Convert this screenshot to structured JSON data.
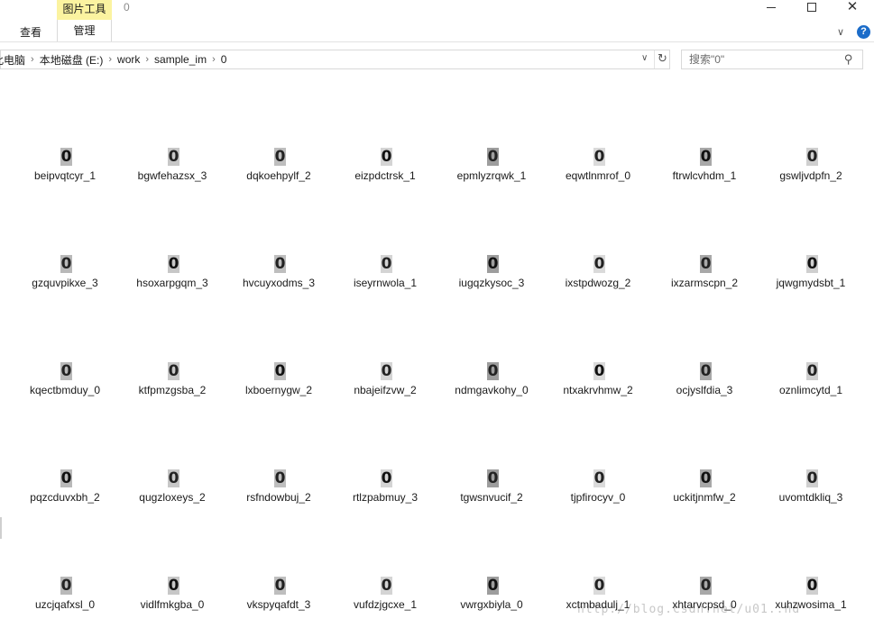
{
  "ribbon": {
    "tab_view": "查看",
    "context_group": "图片工具",
    "tab_manage": "管理",
    "window_title": "0"
  },
  "address": {
    "crumbs": [
      "此电脑",
      "本地磁盘 (E:)",
      "work",
      "sample_im",
      "0"
    ]
  },
  "search": {
    "placeholder": "搜索\"0\""
  },
  "files": [
    {
      "name": "beipvqtcyr_1",
      "glyph": "0"
    },
    {
      "name": "bgwfehazsx_3",
      "glyph": "0"
    },
    {
      "name": "dqkoehpylf_2",
      "glyph": "0"
    },
    {
      "name": "eizpdctrsk_1",
      "glyph": "0"
    },
    {
      "name": "epmlyzrqwk_1",
      "glyph": "0"
    },
    {
      "name": "eqwtlnmrof_0",
      "glyph": "0"
    },
    {
      "name": "ftrwlcvhdm_1",
      "glyph": "0"
    },
    {
      "name": "gswljvdpfn_2",
      "glyph": "0"
    },
    {
      "name": "gzquvpikxe_3",
      "glyph": "0"
    },
    {
      "name": "hsoxarpgqm_3",
      "glyph": "0"
    },
    {
      "name": "hvcuyxodms_3",
      "glyph": "0"
    },
    {
      "name": "iseyrnwola_1",
      "glyph": "0"
    },
    {
      "name": "iugqzkysoc_3",
      "glyph": "0"
    },
    {
      "name": "ixstpdwozg_2",
      "glyph": "0"
    },
    {
      "name": "ixzarmscpn_2",
      "glyph": "0"
    },
    {
      "name": "jqwgmydsbt_1",
      "glyph": "0"
    },
    {
      "name": "kqectbmduy_0",
      "glyph": "0"
    },
    {
      "name": "ktfpmzgsba_2",
      "glyph": "0"
    },
    {
      "name": "lxboernygw_2",
      "glyph": "0"
    },
    {
      "name": "nbajeifzvw_2",
      "glyph": "0"
    },
    {
      "name": "ndmgavkohy_0",
      "glyph": "0"
    },
    {
      "name": "ntxakrvhmw_2",
      "glyph": "0"
    },
    {
      "name": "ocjyslfdia_3",
      "glyph": "0"
    },
    {
      "name": "oznlimcytd_1",
      "glyph": "0"
    },
    {
      "name": "pqzcduvxbh_2",
      "glyph": "0"
    },
    {
      "name": "qugzloxeys_2",
      "glyph": "0"
    },
    {
      "name": "rsfndowbuj_2",
      "glyph": "0"
    },
    {
      "name": "rtlzpabmuy_3",
      "glyph": "0"
    },
    {
      "name": "tgwsnvucif_2",
      "glyph": "0"
    },
    {
      "name": "tjpfirocyv_0",
      "glyph": "0"
    },
    {
      "name": "uckitjnmfw_2",
      "glyph": "0"
    },
    {
      "name": "uvomtdkliq_3",
      "glyph": "0"
    },
    {
      "name": "uzcjqafxsl_0",
      "glyph": "0"
    },
    {
      "name": "vidlfmkgba_0",
      "glyph": "0"
    },
    {
      "name": "vkspyqafdt_3",
      "glyph": "0"
    },
    {
      "name": "vufdzjgcxe_1",
      "glyph": "0"
    },
    {
      "name": "vwrgxbiyla_0",
      "glyph": "0"
    },
    {
      "name": "xctmbadulj_1",
      "glyph": "0"
    },
    {
      "name": "xhtarvcpsd_0",
      "glyph": "0"
    },
    {
      "name": "xuhzwosima_1",
      "glyph": "0"
    }
  ],
  "watermark": "http://blog.csdn.net/u01..nd",
  "colors": {
    "context_tab": "#fbf3a0",
    "help": "#1b6cc9",
    "border": "#d9d9d9"
  },
  "icons": {
    "minimize": "minimize-icon",
    "maximize": "maximize-icon",
    "close": "close-icon",
    "help": "help-icon",
    "refresh": "refresh-icon",
    "search": "search-icon"
  }
}
